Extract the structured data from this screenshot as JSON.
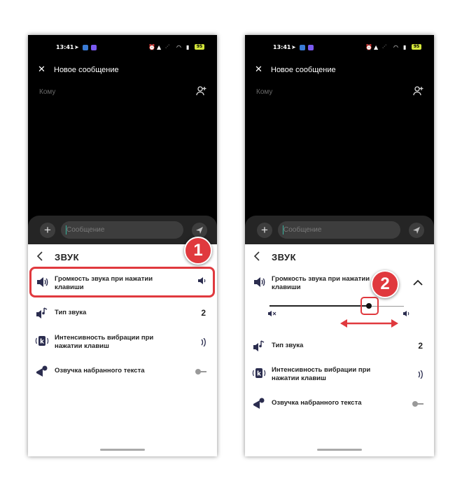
{
  "status": {
    "time": "13:41",
    "battery": "95"
  },
  "header": {
    "title": "Новое сообщение"
  },
  "recipient": {
    "placeholder": "Кому"
  },
  "composer": {
    "placeholder": "Сообщение"
  },
  "sheet": {
    "title": "ЗВУК"
  },
  "settings": {
    "volume": {
      "label": "Громкость звука при нажатии клавиши"
    },
    "sound_type": {
      "label": "Тип звука",
      "value": "2"
    },
    "vibration": {
      "label": "Интенсивность вибрации при нажатии клавиш"
    },
    "voice": {
      "label": "Озвучка набранного текста"
    }
  },
  "slider": {
    "value": 0.74
  },
  "annotations": {
    "step1": "1",
    "step2": "2"
  },
  "colors": {
    "accent": "#e0393e",
    "cursor": "#3ab5a0",
    "battery": "#d4e63b"
  }
}
